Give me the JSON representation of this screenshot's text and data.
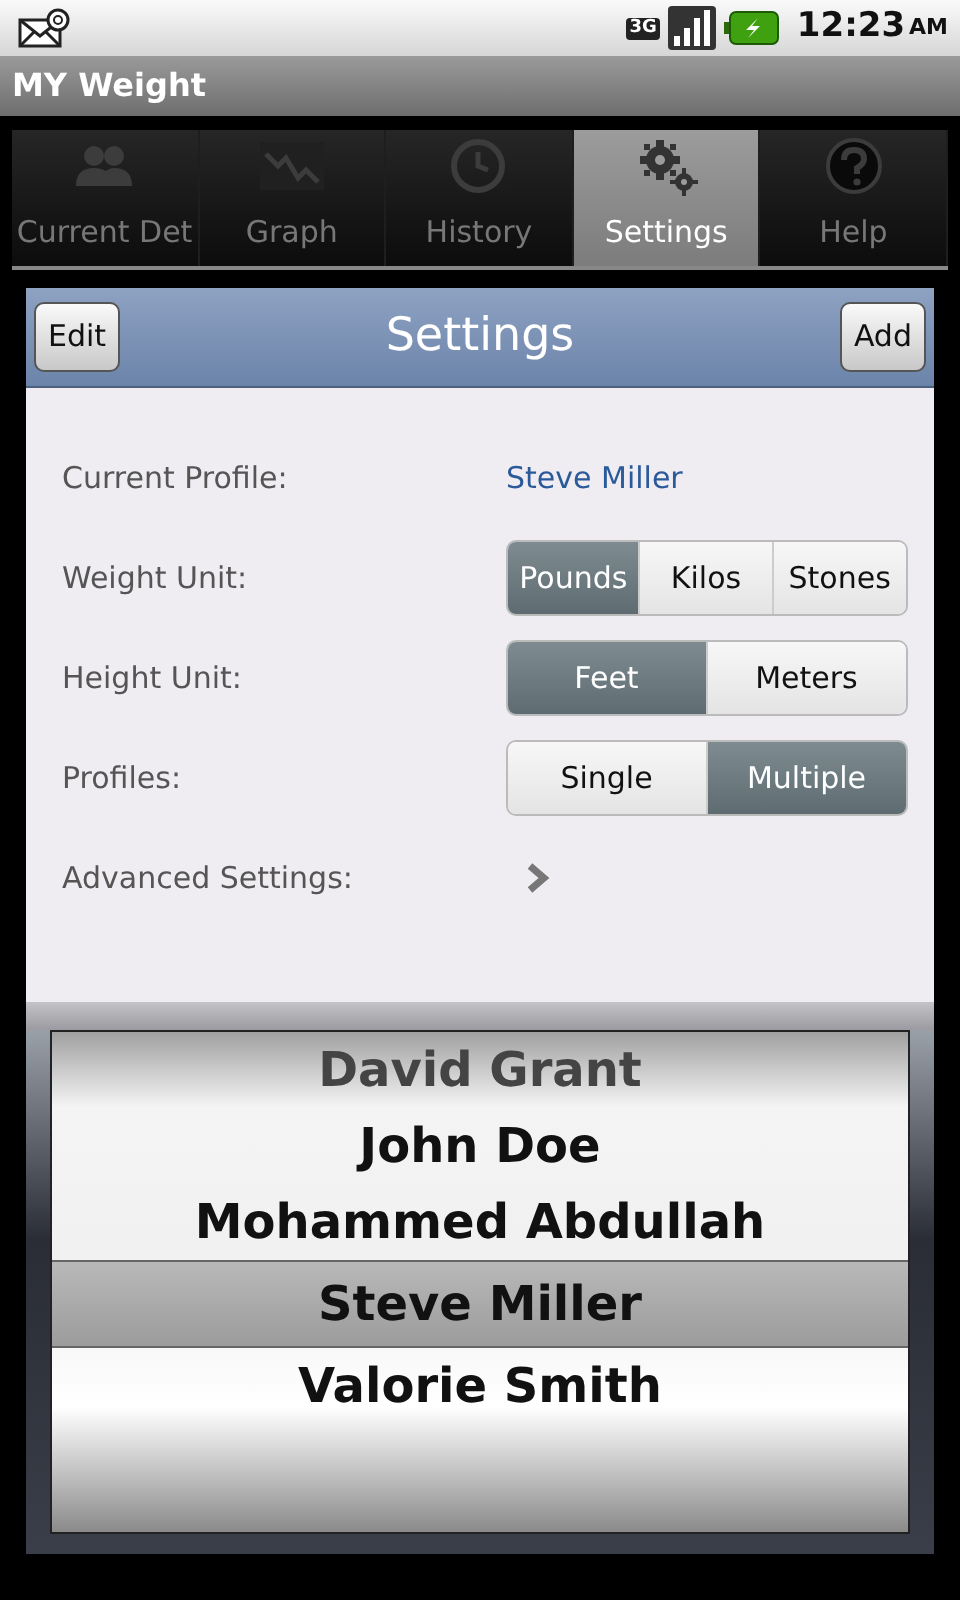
{
  "status_bar": {
    "network": "3G",
    "time": "12:23",
    "meridiem": "AM"
  },
  "app_title": "MY Weight",
  "tabs": [
    {
      "label": "Current Det",
      "selected": false
    },
    {
      "label": "Graph",
      "selected": false
    },
    {
      "label": "History",
      "selected": false
    },
    {
      "label": "Settings",
      "selected": true
    },
    {
      "label": "Help",
      "selected": false
    }
  ],
  "header": {
    "left_button": "Edit",
    "title": "Settings",
    "right_button": "Add"
  },
  "settings": [
    {
      "kind": "text",
      "label": "Current Profile:",
      "value": "Steve Miller"
    },
    {
      "kind": "segmented",
      "label": "Weight Unit:",
      "options": [
        {
          "label": "Pounds",
          "selected": true
        },
        {
          "label": "Kilos",
          "selected": false
        },
        {
          "label": "Stones",
          "selected": false
        }
      ]
    },
    {
      "kind": "segmented",
      "label": "Height Unit:",
      "options": [
        {
          "label": "Feet",
          "selected": true
        },
        {
          "label": "Meters",
          "selected": false
        }
      ]
    },
    {
      "kind": "segmented",
      "label": "Profiles:",
      "options": [
        {
          "label": "Single",
          "selected": false
        },
        {
          "label": "Multiple",
          "selected": true
        }
      ]
    },
    {
      "kind": "disclosure",
      "label": "Advanced Settings:"
    }
  ],
  "picker": [
    {
      "name": "David Grant",
      "selected": false
    },
    {
      "name": "John Doe",
      "selected": false
    },
    {
      "name": "Mohammed Abdullah",
      "selected": false
    },
    {
      "name": "Steve Miller",
      "selected": true
    },
    {
      "name": "Valorie Smith",
      "selected": false
    }
  ]
}
